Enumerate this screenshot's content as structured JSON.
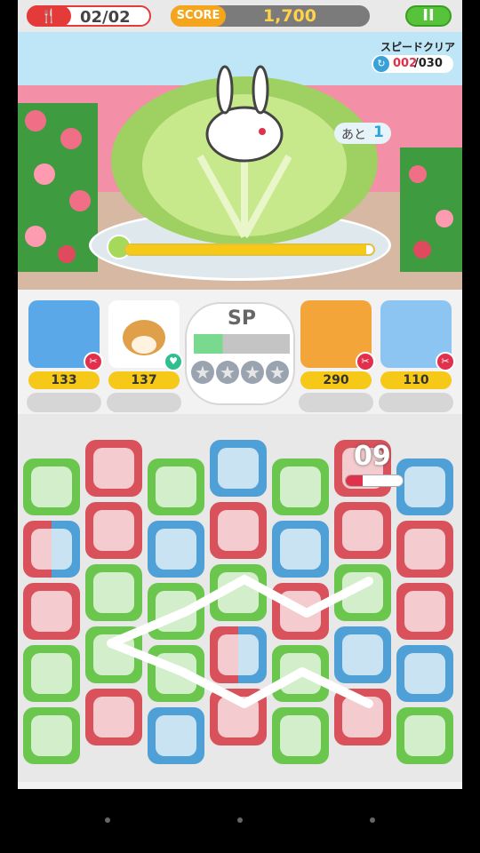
{
  "topbar": {
    "stage_icon": "🍴",
    "stage_text": "02/02",
    "score_label": "SCORE",
    "score_value": "1,700",
    "pause_label": "II"
  },
  "battle": {
    "speed_title": "スピードクリア",
    "speed_current": "002",
    "speed_max": "/030",
    "turns_label": "あと",
    "turns_value": "1",
    "boss_hp_fraction": 0.97
  },
  "team": {
    "members": [
      {
        "attack": "133",
        "icon": "blue-cat-icon",
        "badge": "✂"
      },
      {
        "attack": "137",
        "icon": "shiba-dog-icon",
        "badge": "♥"
      },
      {
        "attack": "290",
        "icon": "golden-pig-icon",
        "badge": "✂"
      },
      {
        "attack": "110",
        "icon": "light-blue-cat-icon",
        "badge": "✂"
      }
    ],
    "sp_label": "SP",
    "sp_fraction": 0.3,
    "star_glyph": "★"
  },
  "board": {
    "combo": "09",
    "combo_fraction": 0.3
  },
  "colors": {
    "green": "#6bc64e",
    "red": "#d9515a",
    "blue": "#4fa0d6",
    "accent_yellow": "#f6c817"
  }
}
